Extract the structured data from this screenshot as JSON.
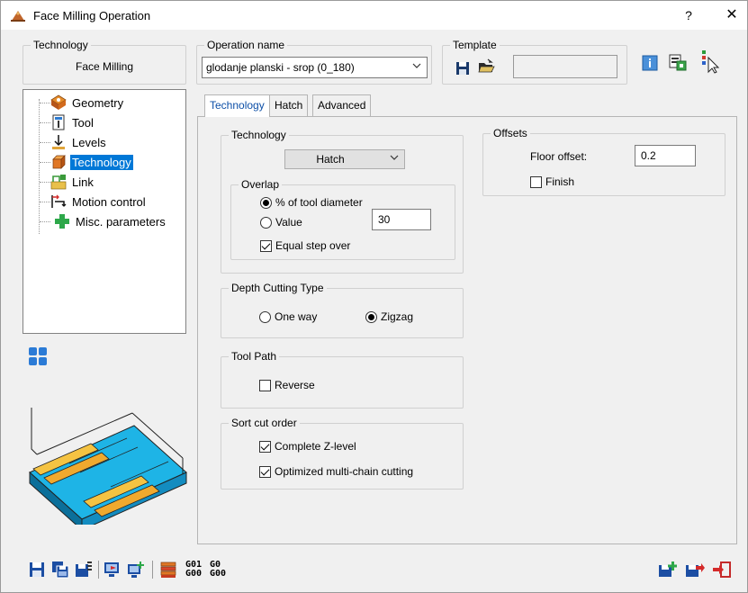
{
  "window": {
    "title": "Face Milling Operation",
    "help_label": "?",
    "close_label": "✕"
  },
  "technology_box": {
    "legend": "Technology",
    "value": "Face Milling"
  },
  "operation_box": {
    "legend": "Operation name",
    "value": "glodanje planski - srop (0_180)"
  },
  "template_box": {
    "legend": "Template",
    "value": ""
  },
  "tree": {
    "items": [
      {
        "label": "Geometry",
        "icon": "geometry-icon"
      },
      {
        "label": "Tool",
        "icon": "tool-icon"
      },
      {
        "label": "Levels",
        "icon": "levels-icon"
      },
      {
        "label": "Technology",
        "icon": "technology-icon",
        "selected": true
      },
      {
        "label": "Link",
        "icon": "link-icon"
      },
      {
        "label": "Motion control",
        "icon": "motion-control-icon"
      },
      {
        "label": "Misc. parameters",
        "icon": "misc-parameters-icon"
      }
    ]
  },
  "tabs": [
    {
      "label": "Technology",
      "active": true
    },
    {
      "label": "Hatch"
    },
    {
      "label": "Advanced"
    }
  ],
  "technology_group": {
    "legend": "Technology",
    "mode": "Hatch",
    "overlap": {
      "legend": "Overlap",
      "percent_label": "% of tool diameter",
      "value_label": "Value",
      "value": "30",
      "equal_step_label": "Equal step over"
    }
  },
  "offsets_group": {
    "legend": "Offsets",
    "floor_offset_label": "Floor offset:",
    "floor_offset_value": "0.2",
    "finish_label": "Finish"
  },
  "depth_group": {
    "legend": "Depth Cutting Type",
    "one_way_label": "One way",
    "zigzag_label": "Zigzag"
  },
  "toolpath_group": {
    "legend": "Tool Path",
    "reverse_label": "Reverse"
  },
  "sort_group": {
    "legend": "Sort cut order",
    "complete_z_label": "Complete Z-level",
    "optimized_label": "Optimized multi-chain cutting"
  },
  "gcode": {
    "top_left": "G01",
    "bottom_left": "G00",
    "top_right": "G0",
    "bottom_right": "G00"
  },
  "colors": {
    "accent": "#0078d7",
    "hatch_yellow": "#f5c342",
    "hatch_blue": "#1eb4e6"
  }
}
